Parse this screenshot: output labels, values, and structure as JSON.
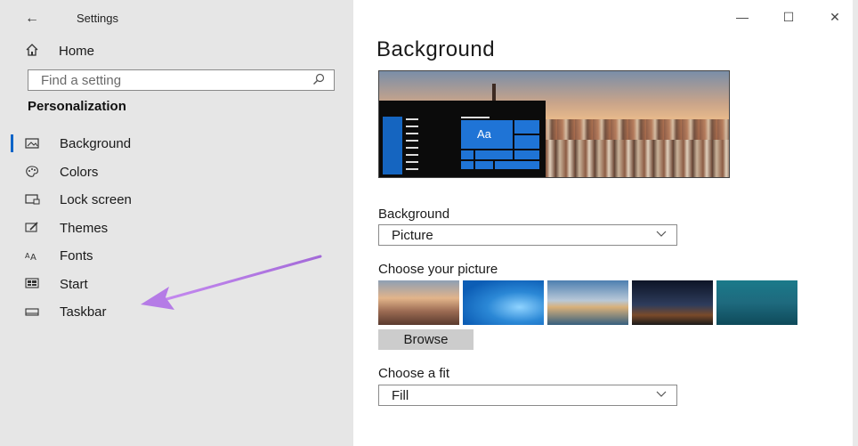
{
  "window": {
    "app_title": "Settings",
    "controls": {
      "minimize": "—",
      "maximize": "☐",
      "close": "✕"
    }
  },
  "sidebar": {
    "home_label": "Home",
    "search_placeholder": "Find a setting",
    "section_title": "Personalization",
    "items": [
      {
        "label": "Background",
        "icon": "picture-icon",
        "active": true
      },
      {
        "label": "Colors",
        "icon": "palette-icon",
        "active": false
      },
      {
        "label": "Lock screen",
        "icon": "lock-screen-icon",
        "active": false
      },
      {
        "label": "Themes",
        "icon": "brush-icon",
        "active": false
      },
      {
        "label": "Fonts",
        "icon": "font-icon",
        "active": false
      },
      {
        "label": "Start",
        "icon": "start-icon",
        "active": false
      },
      {
        "label": "Taskbar",
        "icon": "taskbar-icon",
        "active": false
      }
    ]
  },
  "main": {
    "title": "Background",
    "preview": {
      "tile_text": "Aa"
    },
    "background_label": "Background",
    "background_value": "Picture",
    "choose_picture_label": "Choose your picture",
    "browse_label": "Browse",
    "choose_fit_label": "Choose a fit",
    "fit_value": "Fill"
  },
  "colors": {
    "accent": "#0a64c8",
    "arrow": "#b57be6",
    "sidebar_bg": "#e6e6e6"
  }
}
